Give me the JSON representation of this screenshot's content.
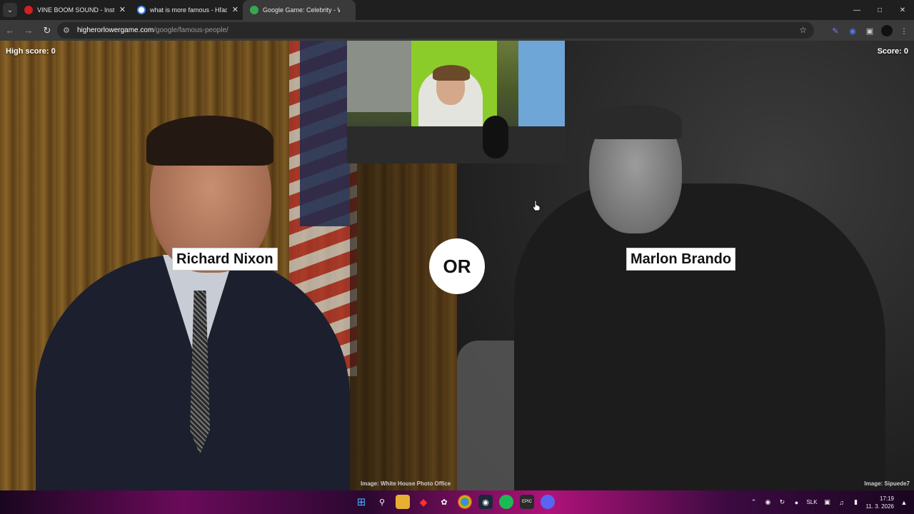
{
  "browser": {
    "tabs": [
      {
        "title": "VINE BOOM SOUND - Instant S",
        "favicon_color": "#d21f1f"
      },
      {
        "title": "what is more famous - Hľadať G",
        "favicon_color": "#ffffff"
      },
      {
        "title": "Google Game: Celebrity - Who",
        "favicon_color": "#36a852"
      }
    ],
    "url_host": "higherorlowergame.com",
    "url_path": "/google/famous-people/"
  },
  "game": {
    "high_score_label": "High score: 0",
    "score_label": "Score: 0",
    "left_name": "Richard Nixon",
    "right_name": "Marlon Brando",
    "or_label": "OR",
    "left_credit": "Image: White House Photo Office",
    "right_credit": "Image: Sipuede7"
  },
  "taskbar": {
    "language": "SLK",
    "time": "17:19",
    "date": "11. 3. 2026"
  }
}
